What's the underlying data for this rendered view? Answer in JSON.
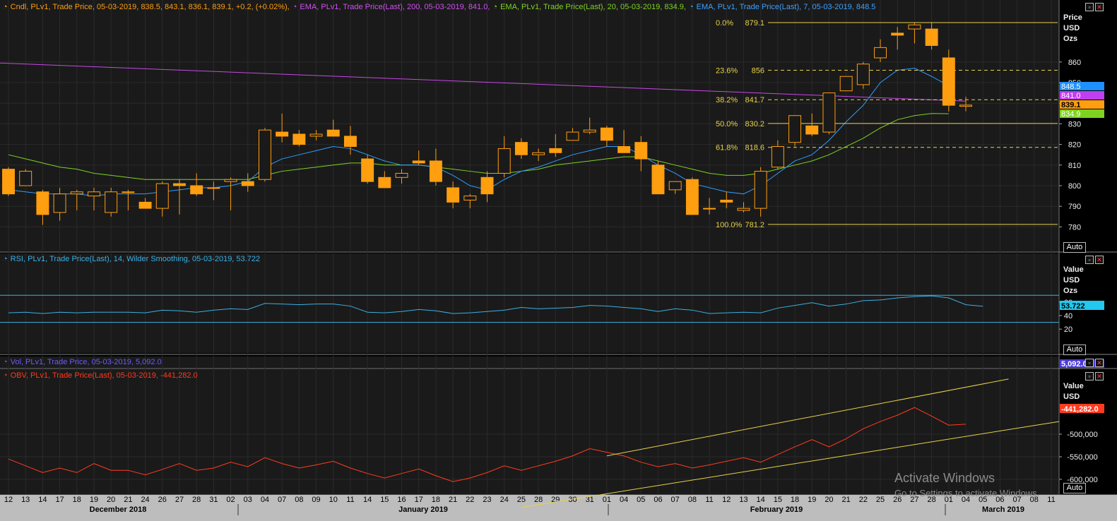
{
  "headers": {
    "price": [
      {
        "text": "Cndl, PLv1, Trade Price, 05-03-2019, 838.5, 843.1, 836.1, 839.1, +0.2, (+0.02%),",
        "color": "#ff9e0f"
      },
      {
        "text": "EMA, PLv1, Trade Price(Last),  200, 05-03-2019, 841.0,",
        "color": "#d050f0"
      },
      {
        "text": "EMA, PLv1, Trade Price(Last),  20, 05-03-2019, 834.9,",
        "color": "#7ed321"
      },
      {
        "text": "EMA, PLv1, Trade Price(Last),  7, 05-03-2019, 848.5",
        "color": "#3ea0ff"
      }
    ],
    "rsi": "RSI, PLv1, Trade Price(Last),  14, Wilder Smoothing,  05-03-2019, 53.722",
    "vol": "Vol, PLv1, Trade Price, 05-03-2019, 5,092.0",
    "obv": "OBV, PLv1, Trade Price(Last), 05-03-2019, -441,282.0"
  },
  "axis_heads": {
    "price": [
      "Price",
      "USD",
      "Ozs"
    ],
    "rsi": [
      "Value",
      "USD",
      "Ozs"
    ],
    "obv": [
      "Value",
      "USD"
    ]
  },
  "auto_label": "Auto",
  "badges": {
    "price": [
      {
        "text": "848.5",
        "bg": "#1e90ff",
        "fg": "#fff"
      },
      {
        "text": "841.0",
        "bg": "#c040f0",
        "fg": "#fff"
      },
      {
        "text": "839.1",
        "bg": "#ff9e0f",
        "fg": "#000"
      },
      {
        "text": "834.9",
        "bg": "#7ed321",
        "fg": "#fff"
      }
    ],
    "rsi": {
      "text": "53.722",
      "bg": "#22c8f0",
      "fg": "#000"
    },
    "vol": {
      "text": "5,092.0",
      "bg": "#4b3bd6",
      "fg": "#fff"
    },
    "obv": {
      "text": "-441,282.0",
      "bg": "#ff3b1f",
      "fg": "#fff"
    }
  },
  "watermark": {
    "title": "Activate Windows",
    "subtitle": "Go to Settings to activate Windows."
  },
  "colors": {
    "candle": "#ff9e0f",
    "ema7": "#2e9cff",
    "ema20": "#7ed321",
    "ema200": "#c848e8",
    "rsi": "#3ab0e6",
    "rsi_bands": "#3ab0e6",
    "obv": "#ff3b1f",
    "fib": "#e8d24a",
    "trend": "#e8d24a",
    "grid": "#2a2a2a"
  },
  "chart_data": {
    "type": "candlestick",
    "dates": [
      "12",
      "13",
      "14",
      "17",
      "18",
      "19",
      "20",
      "21",
      "24",
      "26",
      "27",
      "28",
      "31",
      "02",
      "03",
      "04",
      "07",
      "08",
      "09",
      "10",
      "11",
      "14",
      "15",
      "16",
      "17",
      "18",
      "21",
      "22",
      "23",
      "24",
      "25",
      "28",
      "29",
      "30",
      "31",
      "01",
      "04",
      "05",
      "06",
      "07",
      "08",
      "11",
      "12",
      "13",
      "14",
      "15",
      "18",
      "19",
      "20",
      "21",
      "22",
      "25",
      "26",
      "27",
      "28",
      "01",
      "04",
      "05"
    ],
    "x_tick_labels": [
      "12",
      "13",
      "14",
      "17",
      "18",
      "19",
      "20",
      "21",
      "24",
      "26",
      "27",
      "28",
      "31",
      "02",
      "03",
      "04",
      "07",
      "08",
      "09",
      "10",
      "11",
      "14",
      "15",
      "16",
      "17",
      "18",
      "21",
      "22",
      "23",
      "24",
      "25",
      "28",
      "29",
      "30",
      "31",
      "01",
      "04",
      "05",
      "06",
      "07",
      "08",
      "11",
      "12",
      "13",
      "14",
      "15",
      "18",
      "19",
      "20",
      "21",
      "22",
      "25",
      "26",
      "27",
      "28",
      "01",
      "04",
      "05",
      "06",
      "07",
      "08",
      "11"
    ],
    "month_labels": [
      "December 2018",
      "January 2019",
      "February 2019",
      "March 2019"
    ],
    "price_panel": {
      "ylabel": "Price",
      "y_ticks": [
        780,
        790,
        800,
        810,
        820,
        830,
        840,
        850,
        860
      ],
      "candles": [
        [
          808,
          809,
          795,
          796
        ],
        [
          800,
          808,
          800,
          807
        ],
        [
          797,
          798,
          781,
          786
        ],
        [
          787,
          799,
          783,
          796
        ],
        [
          796,
          798,
          788,
          797
        ],
        [
          795,
          799,
          788,
          797
        ],
        [
          787,
          799,
          785,
          797
        ],
        [
          797,
          798,
          788,
          797
        ],
        [
          792,
          794,
          789,
          789
        ],
        [
          789,
          802,
          785,
          801
        ],
        [
          801,
          803,
          786,
          800
        ],
        [
          800,
          806,
          795,
          796
        ],
        [
          799,
          802,
          793,
          799
        ],
        [
          802,
          804,
          788,
          803
        ],
        [
          802,
          806,
          797,
          800
        ],
        [
          803,
          828,
          802,
          827
        ],
        [
          826,
          835,
          821,
          824
        ],
        [
          825,
          827,
          819,
          820
        ],
        [
          824,
          827,
          822,
          825
        ],
        [
          827,
          832,
          824,
          824
        ],
        [
          824,
          829,
          815,
          819
        ],
        [
          813,
          815,
          801,
          802
        ],
        [
          804,
          807,
          799,
          799
        ],
        [
          804,
          808,
          801,
          806
        ],
        [
          812,
          817,
          810,
          811
        ],
        [
          812,
          818,
          800,
          802
        ],
        [
          799,
          802,
          789,
          792
        ],
        [
          793,
          796,
          789,
          795
        ],
        [
          804,
          807,
          792,
          796
        ],
        [
          806,
          824,
          804,
          818
        ],
        [
          821,
          823,
          813,
          815
        ],
        [
          815,
          818,
          812,
          816
        ],
        [
          818,
          825,
          814,
          816
        ],
        [
          822,
          828,
          822,
          826
        ],
        [
          826,
          833,
          825,
          827
        ],
        [
          828,
          829,
          819,
          822
        ],
        [
          819,
          827,
          818,
          816
        ],
        [
          821,
          824,
          807,
          813
        ],
        [
          810,
          812,
          797,
          796
        ],
        [
          798,
          801,
          796,
          802
        ],
        [
          803,
          804,
          786,
          786
        ],
        [
          789,
          794,
          786,
          789
        ],
        [
          793,
          797,
          789,
          792
        ],
        [
          788,
          792,
          787,
          789
        ],
        [
          789,
          809,
          785,
          807
        ],
        [
          809,
          822,
          808,
          819
        ],
        [
          821,
          834,
          819,
          834
        ],
        [
          829,
          835,
          824,
          825
        ],
        [
          826,
          845,
          825,
          845
        ],
        [
          846,
          853,
          846,
          853
        ],
        [
          849,
          860,
          847,
          859
        ],
        [
          862,
          871,
          860,
          867
        ],
        [
          874,
          877,
          866,
          873
        ],
        [
          876,
          879,
          869,
          878
        ],
        [
          876,
          879,
          866,
          868
        ],
        [
          862,
          866,
          836,
          839
        ],
        [
          838.5,
          843.1,
          836.1,
          839.1
        ]
      ],
      "ema7": [
        798,
        797,
        796,
        796,
        796,
        795,
        796,
        796,
        796,
        797,
        798,
        799,
        799,
        800,
        802,
        809,
        813,
        815,
        817,
        819,
        818,
        815,
        812,
        810,
        810,
        809,
        805,
        800,
        798,
        803,
        807,
        809,
        812,
        815,
        817,
        819,
        819,
        815,
        810,
        806,
        801,
        799,
        797,
        796,
        800,
        806,
        812,
        815,
        822,
        831,
        839,
        850,
        856,
        857,
        853,
        848.5
      ],
      "ema20": [
        815,
        813,
        811,
        809,
        808,
        806,
        805,
        804,
        803,
        803,
        803,
        803,
        803,
        803,
        803,
        805,
        807,
        808,
        809,
        810,
        811,
        811,
        810,
        810,
        810,
        809,
        808,
        807,
        806,
        806,
        807,
        808,
        810,
        811,
        812,
        813,
        814,
        814,
        812,
        810,
        808,
        806,
        805,
        805,
        806,
        808,
        810,
        812,
        815,
        819,
        823,
        828,
        832,
        834,
        835,
        834.9
      ],
      "ema200": {
        "start": 859.5,
        "end": 841.0
      },
      "fibonacci": [
        {
          "pct": "0.0%",
          "value": 879.1,
          "label": "879.1",
          "style": "solid"
        },
        {
          "pct": "23.6%",
          "value": 856.0,
          "label": "856",
          "style": "dashed"
        },
        {
          "pct": "38.2%",
          "value": 841.7,
          "label": "841.7",
          "style": "dashed"
        },
        {
          "pct": "50.0%",
          "value": 830.2,
          "label": "830.2",
          "style": "solid"
        },
        {
          "pct": "61.8%",
          "value": 818.6,
          "label": "818.6",
          "style": "dashed"
        },
        {
          "pct": "100.0%",
          "value": 781.2,
          "label": "781.2",
          "style": "solid"
        }
      ]
    },
    "rsi_panel": {
      "value": 53.722,
      "y_ticks": [
        20,
        40,
        60
      ],
      "bands": [
        70,
        30
      ],
      "values": [
        44,
        45,
        43,
        45,
        44,
        45,
        45,
        45,
        44,
        48,
        47,
        45,
        48,
        50,
        49,
        58,
        57,
        56,
        57,
        57,
        54,
        45,
        44,
        46,
        49,
        47,
        43,
        44,
        46,
        48,
        52,
        50,
        51,
        52,
        55,
        54,
        52,
        50,
        46,
        50,
        48,
        43,
        44,
        45,
        44,
        51,
        55,
        59,
        54,
        57,
        62,
        63,
        66,
        68,
        69,
        66,
        56,
        53.722
      ]
    },
    "vol_panel": {
      "value": 5092.0
    },
    "obv_panel": {
      "y_ticks": [
        -500000,
        -550000,
        -600000
      ],
      "values": [
        -555000,
        -570000,
        -585000,
        -575000,
        -585000,
        -565000,
        -580000,
        -580000,
        -590000,
        -578000,
        -565000,
        -580000,
        -575000,
        -562000,
        -572000,
        -552000,
        -565000,
        -575000,
        -568000,
        -560000,
        -575000,
        -587000,
        -597000,
        -587000,
        -577000,
        -592000,
        -605000,
        -597000,
        -585000,
        -570000,
        -580000,
        -570000,
        -560000,
        -548000,
        -532000,
        -540000,
        -548000,
        -562000,
        -572000,
        -565000,
        -575000,
        -568000,
        -560000,
        -552000,
        -562000,
        -545000,
        -528000,
        -512000,
        -528000,
        -510000,
        -488000,
        -472000,
        -458000,
        -441000,
        -460000,
        -480000,
        -478000
      ],
      "value": -441282.0
    }
  }
}
